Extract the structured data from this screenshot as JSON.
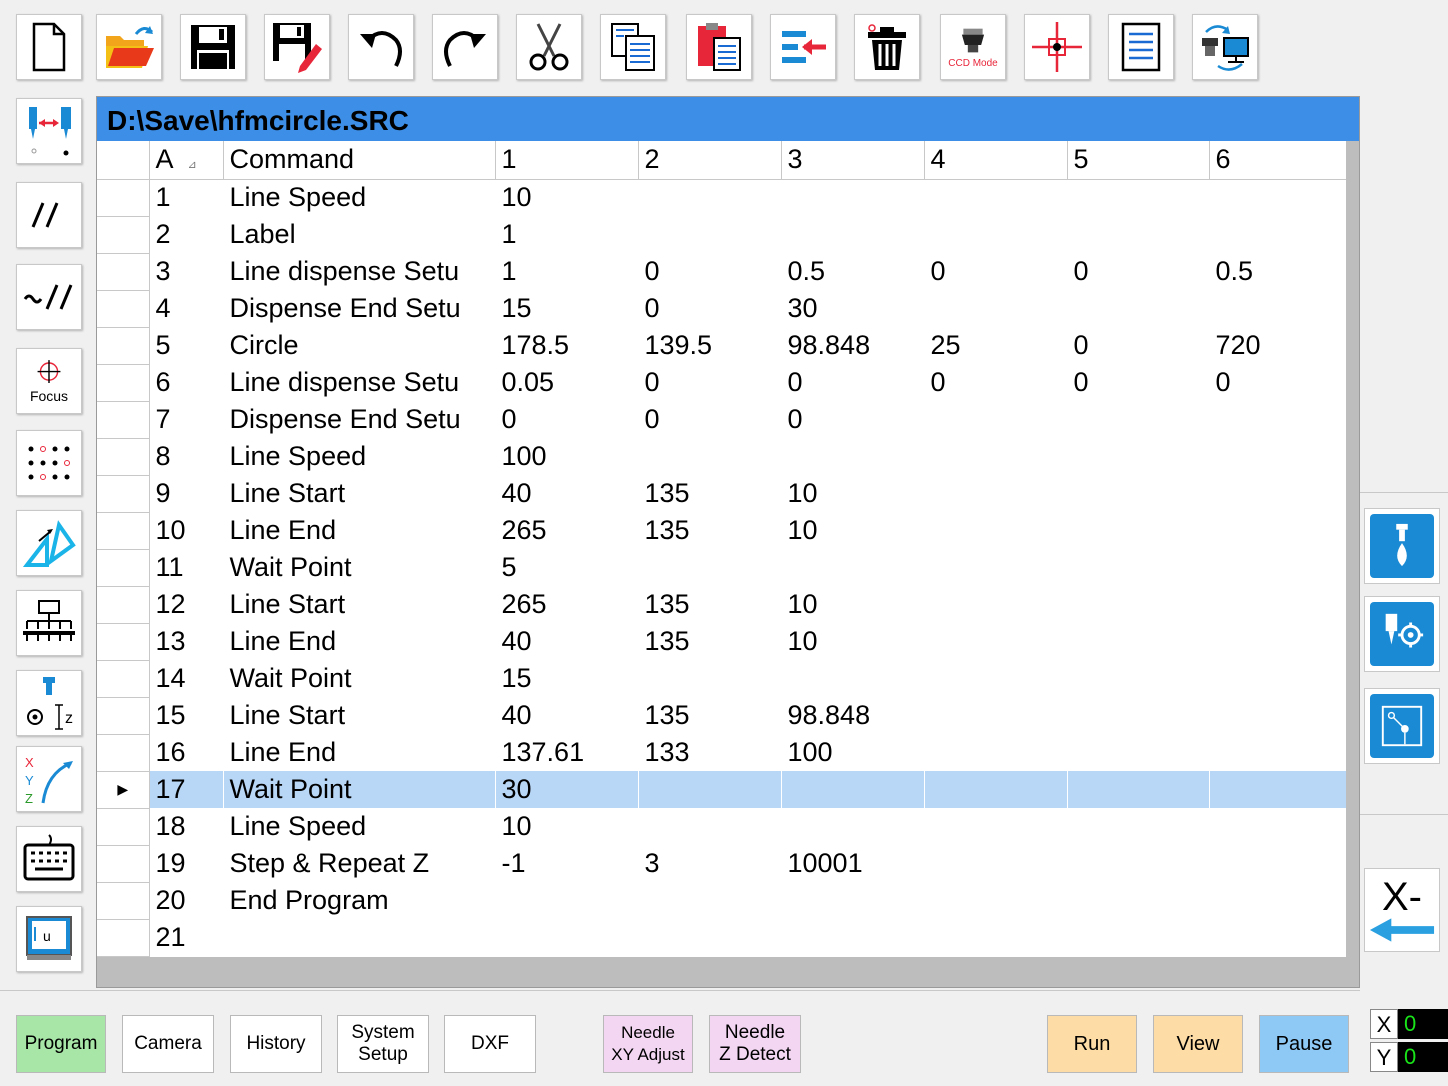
{
  "toolbar": {
    "ccd_mode_label": "CCD Mode",
    "items": [
      "new-file-icon",
      "open-folder-icon",
      "save-icon",
      "save-as-icon",
      "undo-icon",
      "redo-icon",
      "cut-icon",
      "copy-icon",
      "paste-icon",
      "insert-icon",
      "delete-icon",
      "ccd-mode-icon",
      "crosshair-icon",
      "list-icon",
      "camera-sync-icon"
    ]
  },
  "sidebar": {
    "focus_label": "Focus",
    "items": [
      "needle-offset-icon",
      "parallel-lines-icon",
      "wave-lines-icon",
      "focus-icon",
      "dot-array-icon",
      "measure-icon",
      "tree-icon",
      "needle-z-icon",
      "xyz-path-icon",
      "keyboard-icon",
      "software-icon"
    ]
  },
  "program": {
    "file_path": "D:\\Save\\hfmcircle.SRC",
    "headers": [
      "A",
      "Command",
      "1",
      "2",
      "3",
      "4",
      "5",
      "6"
    ],
    "selected_row": 17,
    "rows": [
      [
        "1",
        "Line Speed",
        "10",
        "",
        "",
        "",
        "",
        ""
      ],
      [
        "2",
        "Label",
        "1",
        "",
        "",
        "",
        "",
        ""
      ],
      [
        "3",
        "Line dispense Setu",
        "1",
        "0",
        "0.5",
        "0",
        "0",
        "0.5"
      ],
      [
        "4",
        "Dispense End Setu",
        "15",
        "0",
        "30",
        "",
        "",
        ""
      ],
      [
        "5",
        "Circle",
        "178.5",
        "139.5",
        "98.848",
        "25",
        "0",
        "720"
      ],
      [
        "6",
        "Line dispense Setu",
        "0.05",
        "0",
        "0",
        "0",
        "0",
        "0"
      ],
      [
        "7",
        "Dispense End Setu",
        "0",
        "0",
        "0",
        "",
        "",
        ""
      ],
      [
        "8",
        "Line Speed",
        "100",
        "",
        "",
        "",
        "",
        ""
      ],
      [
        "9",
        "Line Start",
        "40",
        "135",
        "10",
        "",
        "",
        ""
      ],
      [
        "10",
        "Line End",
        "265",
        "135",
        "10",
        "",
        "",
        ""
      ],
      [
        "11",
        "Wait Point",
        "5",
        "",
        "",
        "",
        "",
        ""
      ],
      [
        "12",
        "Line Start",
        "265",
        "135",
        "10",
        "",
        "",
        ""
      ],
      [
        "13",
        "Line End",
        "40",
        "135",
        "10",
        "",
        "",
        ""
      ],
      [
        "14",
        "Wait Point",
        "15",
        "",
        "",
        "",
        "",
        ""
      ],
      [
        "15",
        "Line Start",
        "40",
        "135",
        "98.848",
        "",
        "",
        ""
      ],
      [
        "16",
        "Line End",
        "137.61",
        "133",
        "100",
        "",
        "",
        ""
      ],
      [
        "17",
        "Wait Point",
        "30",
        "",
        "",
        "",
        "",
        ""
      ],
      [
        "18",
        "Line Speed",
        "10",
        "",
        "",
        "",
        "",
        ""
      ],
      [
        "19",
        "Step & Repeat Z",
        "-1",
        "3",
        "10001",
        "",
        "",
        ""
      ],
      [
        "20",
        "End Program",
        "",
        "",
        "",
        "",
        "",
        ""
      ],
      [
        "21",
        "",
        "",
        "",
        "",
        "",
        "",
        ""
      ]
    ]
  },
  "right_panel": {
    "jog_label": "X-"
  },
  "bottom": {
    "program": "Program",
    "camera": "Camera",
    "history": "History",
    "system_setup_1": "System",
    "system_setup_2": "Setup",
    "dxf": "DXF",
    "needle_xy_1": "Needle",
    "needle_xy_2": "XY Adjust",
    "needle_z_1": "Needle",
    "needle_z_2": "Z Detect",
    "run": "Run",
    "view": "View",
    "pause": "Pause"
  },
  "coords": {
    "x_label": "X",
    "x_value": "0",
    "y_label": "Y",
    "y_value": "0"
  },
  "colors": {
    "title_bar": "#3d8ee6",
    "selected_row": "#b8d6f5",
    "program_tab": "#a8e6a8",
    "needle_buttons": "#f2d6f2",
    "run_view": "#fddca5",
    "pause": "#8ec8f5",
    "coord_text": "#19e319"
  }
}
